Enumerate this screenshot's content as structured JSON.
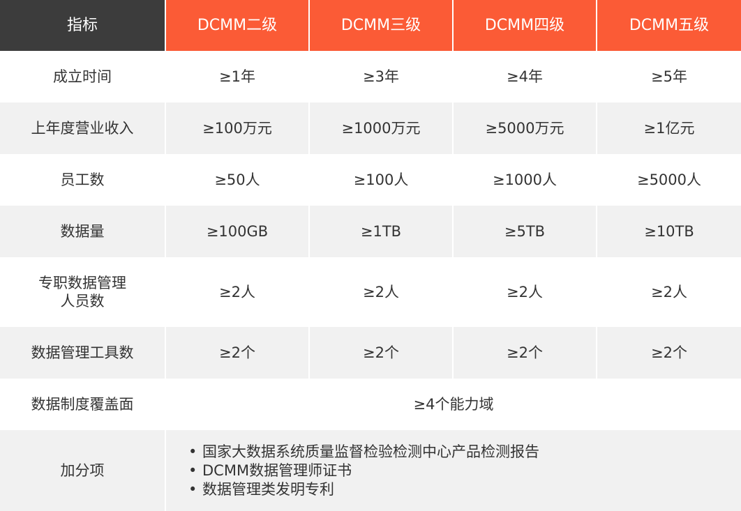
{
  "header": {
    "indicator": "指标",
    "levels": [
      "DCMM二级",
      "DCMM三级",
      "DCMM四级",
      "DCMM五级"
    ]
  },
  "rows": [
    {
      "label": "成立时间",
      "values": [
        "≥1年",
        "≥3年",
        "≥4年",
        "≥5年"
      ]
    },
    {
      "label": "上年度营业收入",
      "values": [
        "≥100万元",
        "≥1000万元",
        "≥5000万元",
        "≥1亿元"
      ]
    },
    {
      "label": "员工数",
      "values": [
        "≥50人",
        "≥100人",
        "≥1000人",
        "≥5000人"
      ]
    },
    {
      "label": "数据量",
      "values": [
        "≥100GB",
        "≥1TB",
        "≥5TB",
        "≥10TB"
      ]
    },
    {
      "label": "专职数据管理\n人员数",
      "values": [
        "≥2人",
        "≥2人",
        "≥2人",
        "≥2人"
      ]
    },
    {
      "label": "数据管理工具数",
      "values": [
        "≥2个",
        "≥2个",
        "≥2个",
        "≥2个"
      ]
    }
  ],
  "coverage": {
    "label": "数据制度覆盖面",
    "value": "≥4个能力域"
  },
  "bonus": {
    "label": "加分项",
    "items": [
      "国家大数据系统质量监督检验检测中心产品检测报告",
      "DCMM数据管理师证书",
      "数据管理类发明专利"
    ]
  },
  "colors": {
    "accent": "#fb5b36",
    "header_dark": "#3c3c3c",
    "row_gray": "#f1f1f1"
  }
}
